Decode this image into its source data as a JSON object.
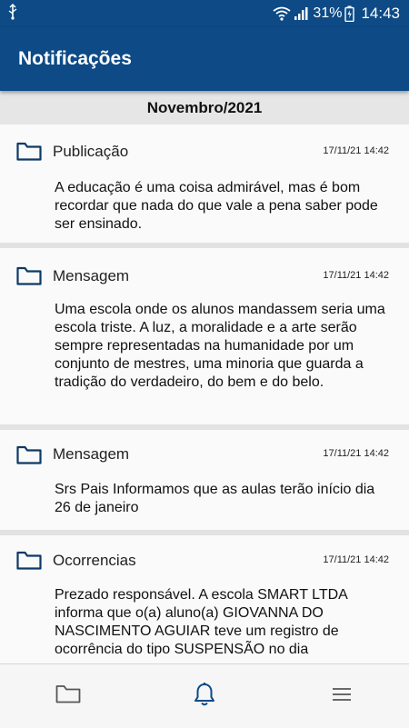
{
  "status_bar": {
    "usb_icon": "usb-icon",
    "wifi_icon": "wifi-icon",
    "signal_icon": "signal-icon",
    "battery_percent": "31%",
    "battery_icon": "battery-charging-icon",
    "time": "14:43"
  },
  "app_bar": {
    "title": "Notificações"
  },
  "month_header": "Novembro/2021",
  "notifications": [
    {
      "icon": "folder-icon",
      "type": "Publicação",
      "date": "17/11/21 14:42",
      "body": "A educação é uma coisa admirável, mas é bom recordar que nada do que vale a pena saber pode ser ensinado."
    },
    {
      "icon": "folder-icon",
      "type": "Mensagem",
      "date": "17/11/21 14:42",
      "body": "Uma escola onde os alunos mandassem seria uma escola triste. A luz, a moralidade e a arte serão sempre representadas na humanidade por um conjunto de mestres, uma minoria que guarda a tradição do verdadeiro, do bem e do belo."
    },
    {
      "icon": "folder-icon",
      "type": "Mensagem",
      "date": "17/11/21 14:42",
      "body": "Srs Pais Informamos que as aulas terão início dia 26 de janeiro"
    },
    {
      "icon": "folder-icon",
      "type": "Ocorrencias",
      "date": "17/11/21 14:42",
      "body": "Prezado responsável. A escola SMART LTDA informa que o(a) aluno(a) GIOVANNA DO NASCIMENTO AGUIAR teve um registro de ocorrência do tipo SUSPENSÃO no dia"
    }
  ],
  "bottom_nav": [
    {
      "icon": "folder-icon",
      "active": false
    },
    {
      "icon": "bell-icon",
      "active": true
    },
    {
      "icon": "menu-icon",
      "active": false
    }
  ],
  "colors": {
    "primary": "#0d4a86",
    "folder_stroke": "#0d3a66",
    "background": "#f5f5f5",
    "card": "#fafafa",
    "separator": "#e2e2e2",
    "month_header_bg": "#e6e6e6",
    "nav_inactive": "#555555"
  }
}
